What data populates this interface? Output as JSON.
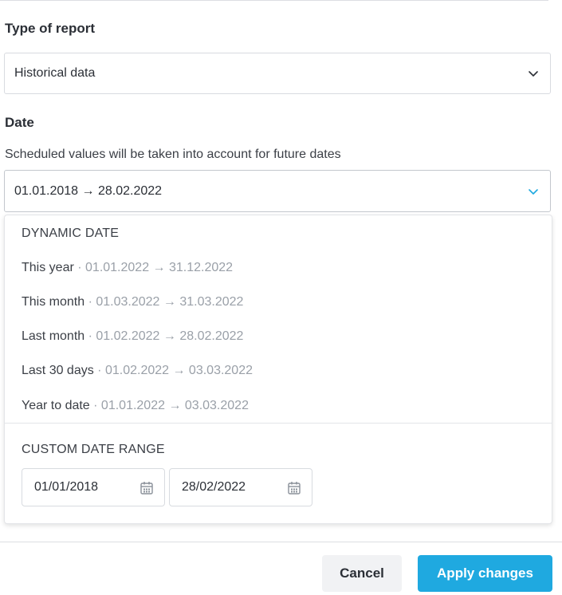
{
  "report_type": {
    "label": "Type of report",
    "value": "Historical data"
  },
  "date": {
    "label": "Date",
    "hint": "Scheduled values will be taken into account for future dates",
    "value": "01.01.2018 → 28.02.2022"
  },
  "dropdown": {
    "dynamic_title": "DYNAMIC DATE",
    "options": [
      {
        "name": "This year",
        "range": " · 01.01.2022 → 31.12.2022"
      },
      {
        "name": "This month",
        "range": " · 01.03.2022 → 31.03.2022"
      },
      {
        "name": "Last month",
        "range": " · 01.02.2022 → 28.02.2022"
      },
      {
        "name": "Last 30 days",
        "range": " · 01.02.2022 → 03.03.2022"
      },
      {
        "name": "Year to date",
        "range": " · 01.01.2022 → 03.03.2022"
      }
    ],
    "custom_title": "CUSTOM DATE RANGE",
    "start_date": "01/01/2018",
    "end_date": "28/02/2022"
  },
  "actions": {
    "cancel_label": "Cancel",
    "apply_label": "Apply changes"
  },
  "colors": {
    "accent": "#1fa9e0",
    "muted_text": "#9aa0a8"
  }
}
